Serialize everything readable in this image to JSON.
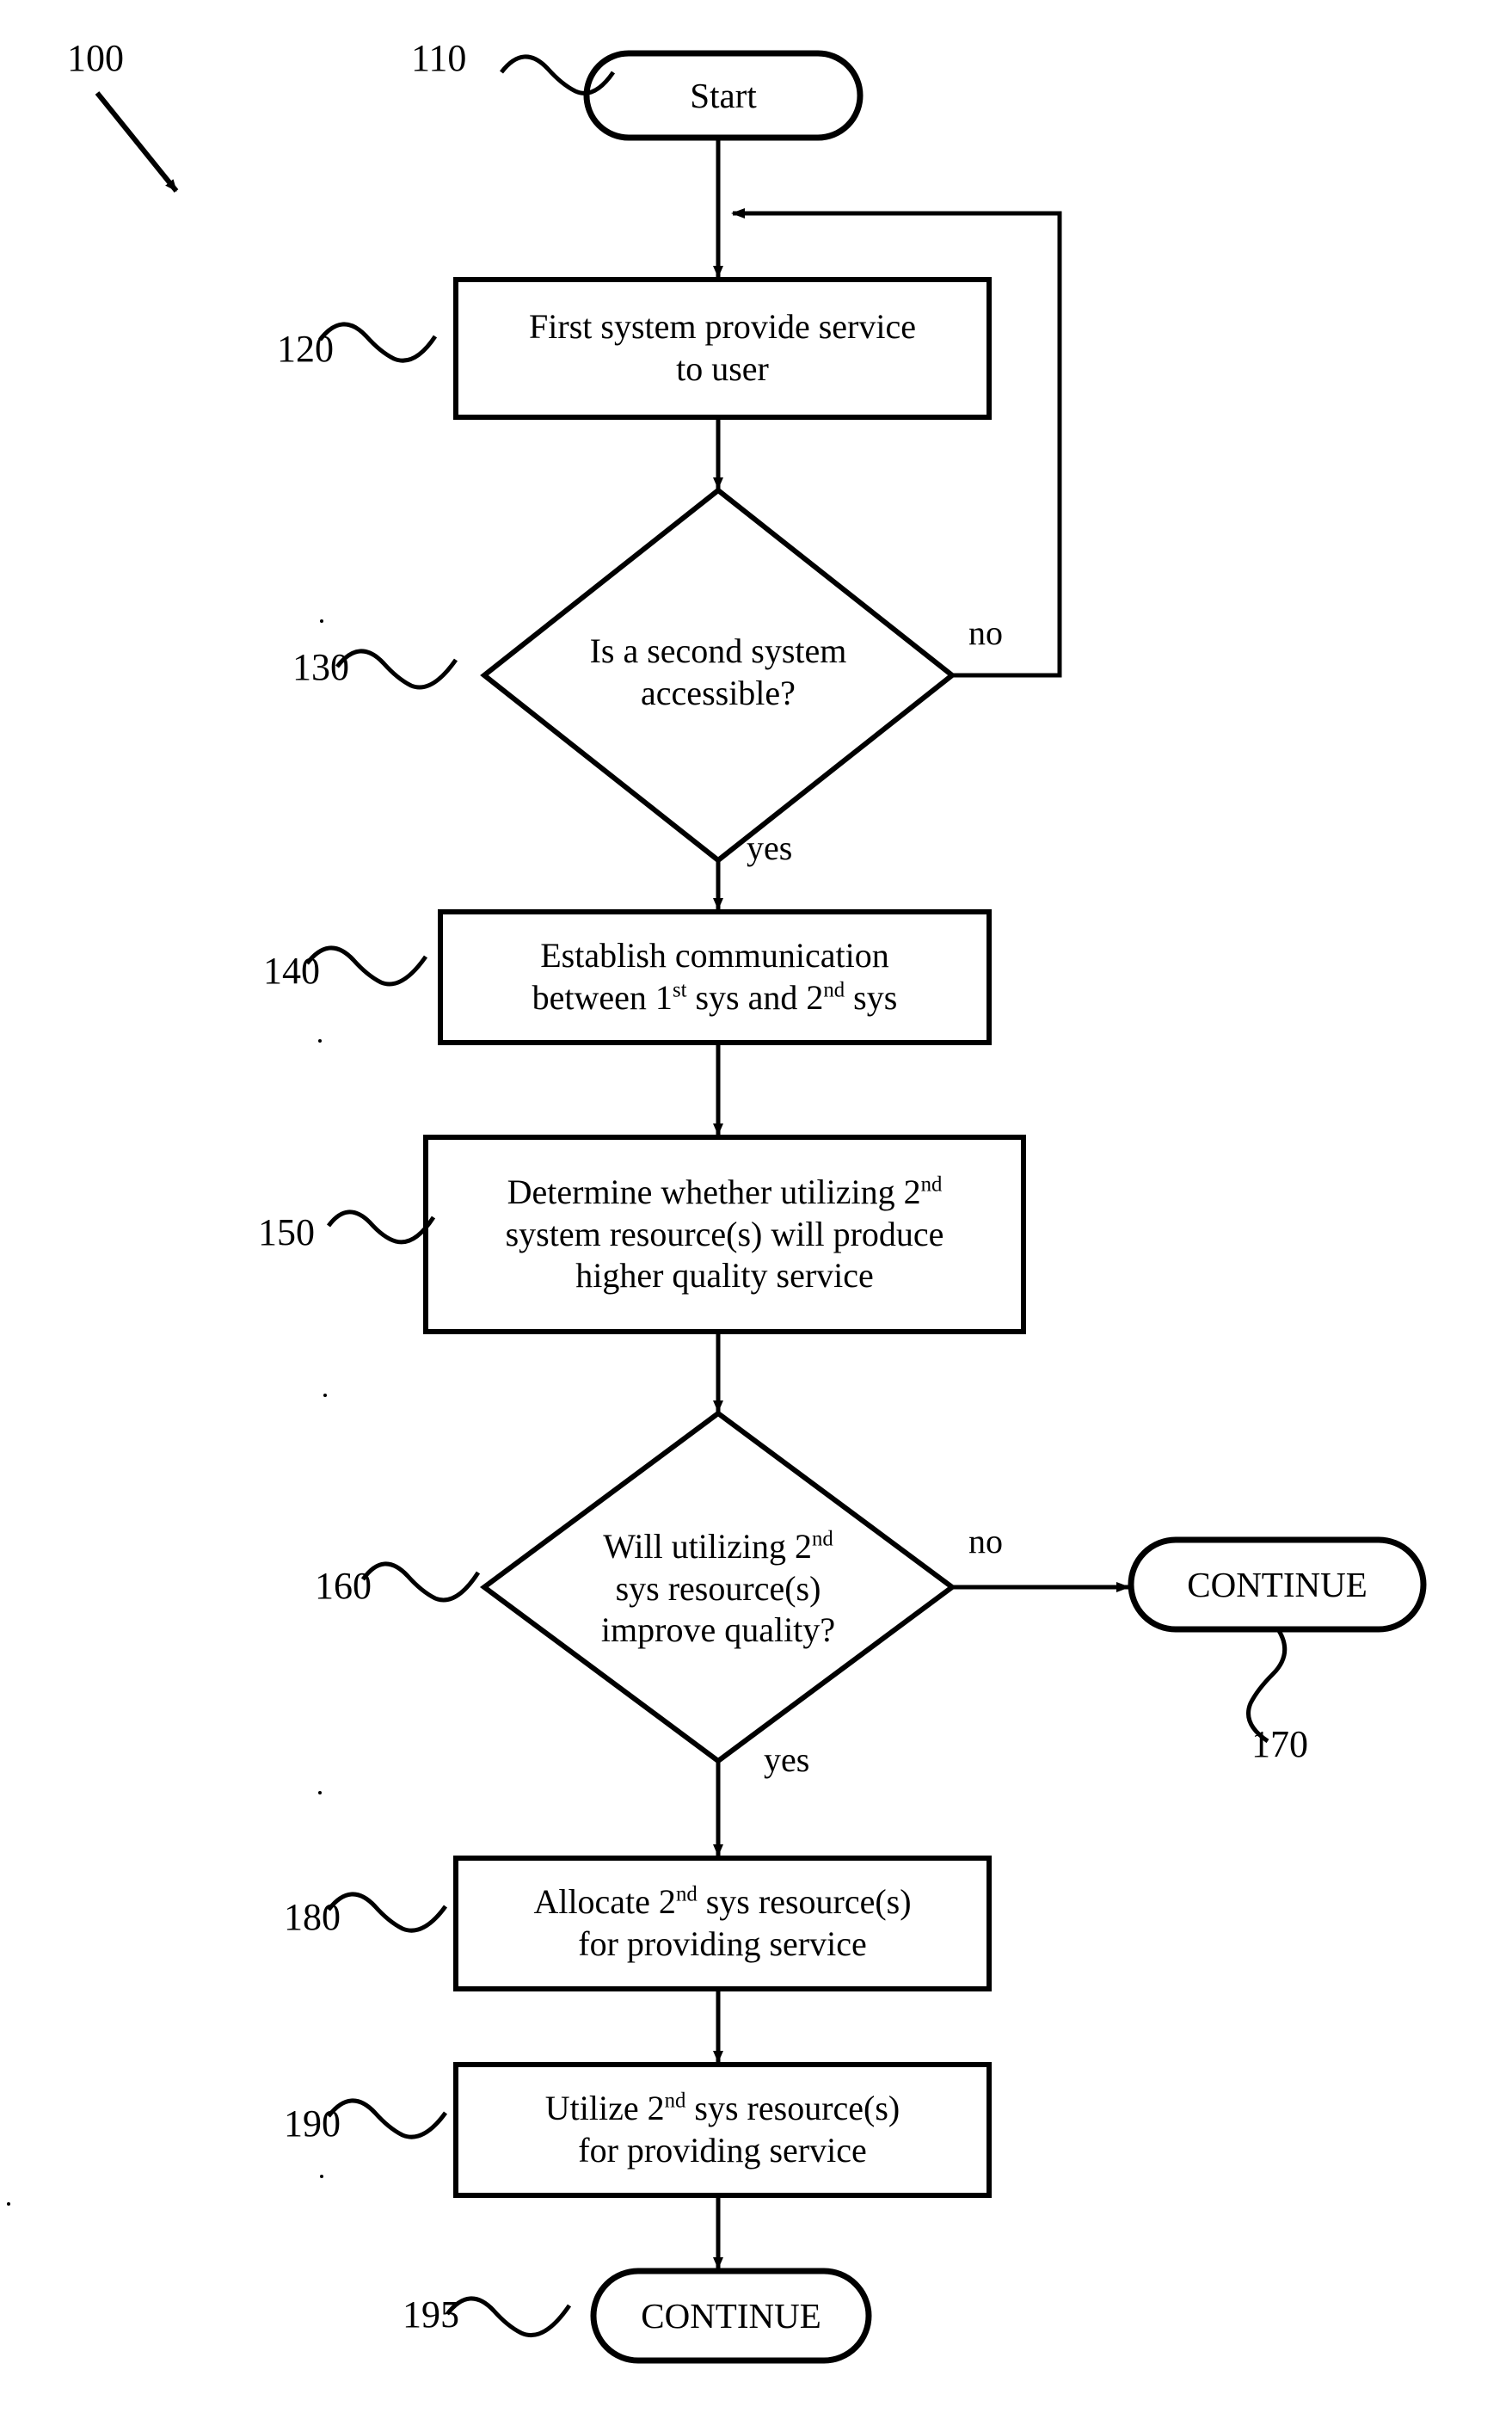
{
  "figure": {
    "reference_label": "100",
    "background_color": "#ffffff",
    "line_color": "#000000"
  },
  "nodes": [
    {
      "id": "start",
      "ref": "110",
      "shape": "terminator",
      "lines": [
        "Start"
      ]
    },
    {
      "id": "first-system-provide-service",
      "ref": "120",
      "shape": "process",
      "lines": [
        "First system provide service",
        "to user"
      ]
    },
    {
      "id": "is-second-system-accessible",
      "ref": "130",
      "shape": "decision",
      "lines": [
        "Is a second system",
        "accessible?"
      ]
    },
    {
      "id": "establish-communication",
      "ref": "140",
      "shape": "process",
      "lines": [
        "Establish communication",
        "between 1st sys and 2nd sys"
      ]
    },
    {
      "id": "determine-higher-quality",
      "ref": "150",
      "shape": "process",
      "lines": [
        "Determine whether utilizing 2nd",
        "system resource(s) will produce",
        "higher quality service"
      ]
    },
    {
      "id": "will-improve-quality",
      "ref": "160",
      "shape": "decision",
      "lines": [
        "Will utilizing 2nd",
        "sys resource(s)",
        "improve quality?"
      ]
    },
    {
      "id": "continue-no-branch",
      "ref": "170",
      "shape": "terminator",
      "lines": [
        "CONTINUE"
      ]
    },
    {
      "id": "allocate-resources",
      "ref": "180",
      "shape": "process",
      "lines": [
        "Allocate 2nd sys resource(s)",
        "for providing service"
      ]
    },
    {
      "id": "utilize-resources",
      "ref": "190",
      "shape": "process",
      "lines": [
        "Utilize 2nd sys resource(s)",
        "for providing service"
      ]
    },
    {
      "id": "continue-end",
      "ref": "195",
      "shape": "terminator",
      "lines": [
        "CONTINUE"
      ]
    }
  ],
  "edge_labels": {
    "decision_130_no": "no",
    "decision_130_yes": "yes",
    "decision_160_no": "no",
    "decision_160_yes": "yes"
  }
}
